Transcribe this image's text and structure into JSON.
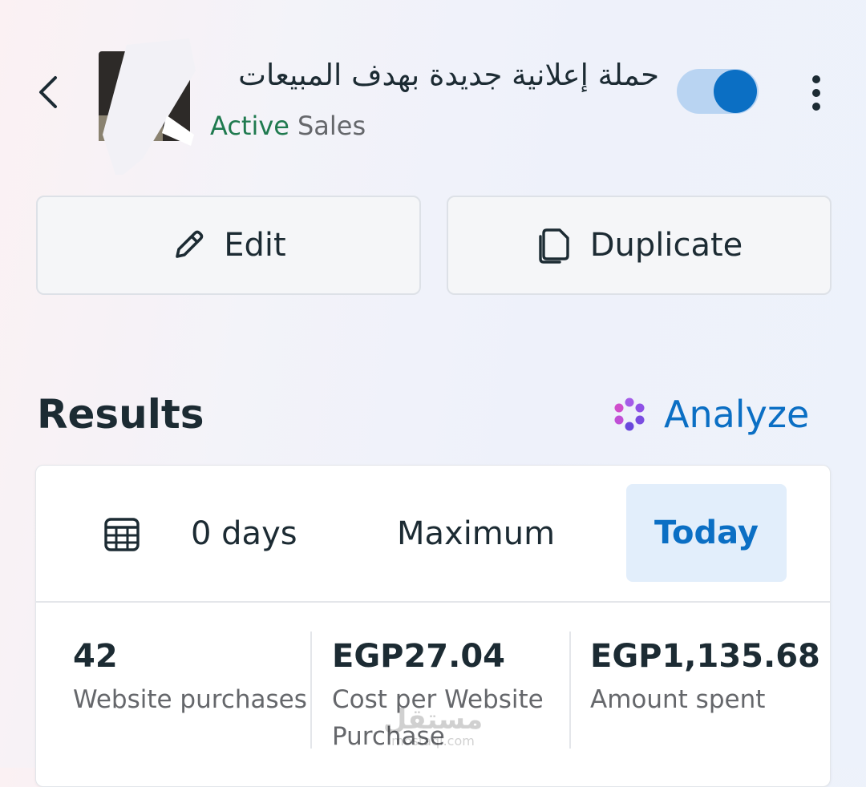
{
  "header": {
    "back_icon": "chevron-left-icon",
    "campaign_title": "حملة إعلانية جديدة بهدف المبيعات",
    "status": "Active",
    "objective": "Sales",
    "toggle_on": true,
    "more_icon": "more-vertical-icon"
  },
  "actions": {
    "edit_label": "Edit",
    "edit_icon": "pencil-icon",
    "duplicate_label": "Duplicate",
    "duplicate_icon": "copy-icon"
  },
  "results": {
    "title": "Results",
    "analyze_label": "Analyze",
    "analyze_icon": "sparkle-icon"
  },
  "date_range": {
    "calendar_icon": "calendar-icon",
    "options": [
      "0 days",
      "Maximum",
      "Today"
    ],
    "selected": "Today"
  },
  "metrics": [
    {
      "value": "42",
      "label": "Website purchases"
    },
    {
      "value": "EGP27.04",
      "label": "Cost per Website Purchase"
    },
    {
      "value": "EGP1,135.68",
      "label": "Amount spent"
    }
  ],
  "watermark": {
    "arabic": "مستقل",
    "latin": "mostaql.com"
  },
  "colors": {
    "accent": "#0b6fc4",
    "active_green": "#1f7a4f",
    "toggle_track": "#b9d4f2",
    "selected_bg": "#e2eefb",
    "text": "#1c2b33",
    "muted": "#65676b"
  }
}
